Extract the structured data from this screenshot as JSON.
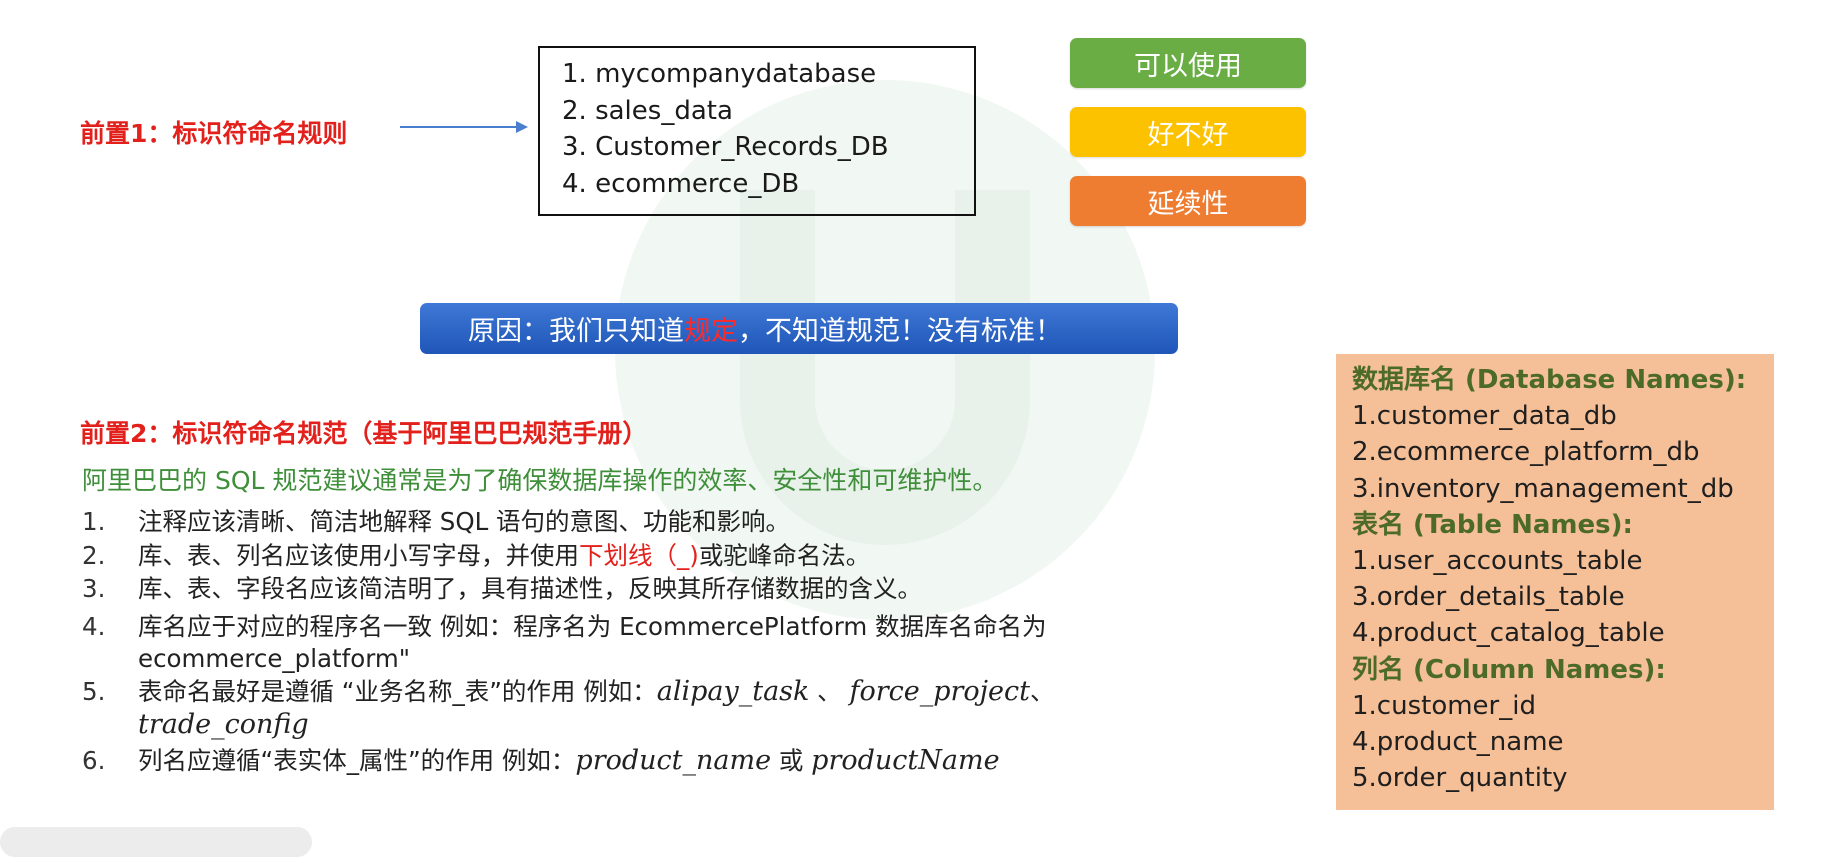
{
  "rule1": {
    "title": "前置1：标识符命名规则"
  },
  "examples": [
    "1. mycompanydatabase",
    "2. sales_data",
    "3. Customer_Records_DB",
    "4. ecommerce_DB"
  ],
  "tags": [
    {
      "label": "可以使用",
      "color": "#6aad45"
    },
    {
      "label": "好不好",
      "color": "#fcc200"
    },
    {
      "label": "延续性",
      "color": "#ee7d31"
    }
  ],
  "banner": {
    "prefix": "原因：我们只知道",
    "highlight": "规定",
    "suffix": "，不知道规范！没有标准！"
  },
  "rule2": {
    "title": "前置2：标识符命名规范（基于阿里巴巴规范手册）",
    "subtitle": "阿里巴巴的 SQL 规范建议通常是为了确保数据库操作的效率、安全性和可维护性。"
  },
  "list": {
    "item1": {
      "num": "1.",
      "text": "注释应该清晰、简洁地解释 SQL 语句的意图、功能和影响。"
    },
    "item2": {
      "num": "2.",
      "before": "库、表、列名应该使用小写字母，并使用",
      "red": "下划线（_)",
      "after": "或驼峰命名法。"
    },
    "item3": {
      "num": "3.",
      "text": "库、表、字段名应该简洁明了，具有描述性，反映其所存储数据的含义。"
    },
    "item4": {
      "num": "4.",
      "text": "库名应于对应的程序名一致 例如：程序名为 EcommercePlatform 数据库名命名为",
      "cont": "ecommerce_platform\""
    },
    "item5": {
      "num": "5.",
      "before": "表命名最好是遵循 “业务名称_表”的作用 例如：",
      "ex1": "alipay_task",
      "sep1": " 、 ",
      "ex2": "force_project",
      "sep2": "、",
      "cont": "trade_config"
    },
    "item6": {
      "num": "6.",
      "before": "列名应遵循“表实体_属性”的作用 例如：",
      "ex1": "product_name",
      "sep": " 或 ",
      "ex2": "productName"
    }
  },
  "panel": {
    "db_header": "数据库名 (Database Names):",
    "db_items": [
      "1.customer_data_db",
      "2.ecommerce_platform_db",
      "3.inventory_management_db"
    ],
    "table_header": "表名 (Table Names):",
    "table_items": [
      "1.user_accounts_table",
      "3.order_details_table",
      "4.product_catalog_table"
    ],
    "col_header": "列名 (Column Names):",
    "col_items": [
      "1.customer_id",
      "4.product_name",
      "5.order_quantity"
    ]
  }
}
